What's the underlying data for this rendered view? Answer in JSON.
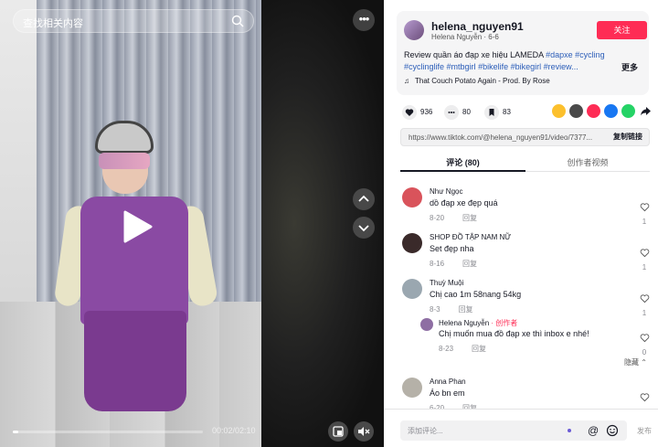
{
  "video": {
    "search_placeholder": "查找相关内容",
    "time": "00:02/02:10",
    "progress": 0.03
  },
  "post": {
    "username": "helena_nguyen91",
    "display_name": "Helena Nguyễn",
    "date": "6-6",
    "follow_label": "关注",
    "description_text": "Review quần áo đạp xe hiệu LAMEDA ",
    "hashtags": [
      "#dapxe",
      "#cycling",
      "#cyclinglife",
      "#mtbgirl",
      "#bikelife",
      "#bikegirl",
      "#review..."
    ],
    "more_label": "更多",
    "music": "That Couch Potato Again - Prod. By Rose",
    "likes": "936",
    "comments_count": "80",
    "saves": "83",
    "link": "https://www.tiktok.com/@helena_nguyen91/video/7377...",
    "copy_label": "复制链接"
  },
  "tabs": {
    "comments": "评论 (80)",
    "creator_videos": "创作者视频"
  },
  "comments": [
    {
      "name": "Như Ngọc",
      "text": "dồ đạp xe đẹp quá",
      "date": "8-20",
      "reply": "回复",
      "likes": "1",
      "avatar": "#d9535b"
    },
    {
      "name": "SHOP ĐỒ TẬP NAM NỮ",
      "text": "Set đẹp nha",
      "date": "8-16",
      "reply": "回复",
      "likes": "1",
      "avatar": "#3a2a2a"
    },
    {
      "name": "Thuỳ Muội",
      "text": "Chị cao 1m 58nang 54kg",
      "date": "8-3",
      "reply": "回复",
      "likes": "1",
      "avatar": "#9aa7b0"
    },
    {
      "name": "Helena Nguyễn",
      "badge": " · 创作者",
      "text": "Chị muốn mua đồ đạp xe thì inbox e nhé!",
      "date": "8-23",
      "reply": "回复",
      "likes": "0",
      "avatar": "#8e6ea3"
    },
    {
      "name": "Anna Phan",
      "text": "Áo bn em",
      "date": "6-20",
      "reply": "回复",
      "likes": "1",
      "avatar": "#b5b1a8"
    }
  ],
  "hide_label": "隐藏",
  "compose": {
    "placeholder": "添加评论...",
    "send_label": "发布"
  },
  "colors": {
    "accent": "#fe2c55",
    "hashtag": "#2b5db8"
  }
}
